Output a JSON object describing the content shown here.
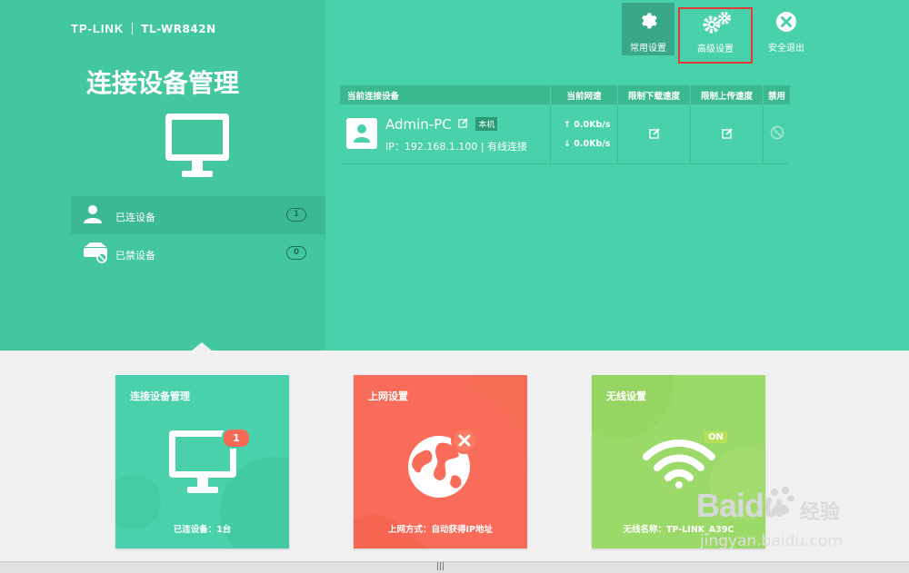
{
  "brand": {
    "logo": "TP-LINK",
    "model": "TL-WR842N"
  },
  "page_title": "连接设备管理",
  "nav": [
    {
      "label": "已连设备",
      "count": "1",
      "icon": "user-icon"
    },
    {
      "label": "已禁设备",
      "count": "0",
      "icon": "blocked-device-icon"
    }
  ],
  "top_buttons": {
    "common": "常用设置",
    "advanced": "高级设置",
    "exit": "安全退出"
  },
  "device_table": {
    "headers": [
      "当前连接设备",
      "当前网速",
      "限制下载速度",
      "限制上传速度",
      "禁用"
    ],
    "rows": [
      {
        "name": "Admin-PC",
        "tag": "本机",
        "ip": "IP：192.168.1.100 | 有线连接",
        "up": "0.0Kb/s",
        "down": "0.0Kb/s"
      }
    ]
  },
  "cards": [
    {
      "title": "连接设备管理",
      "badge": "1",
      "footer": "已连设备：1台"
    },
    {
      "title": "上网设置",
      "footer": "上网方式：自动获得IP地址"
    },
    {
      "title": "无线设置",
      "badge": "ON",
      "footer": "无线名称：TP-LINK_A39C"
    }
  ],
  "watermark": {
    "logo": "Baidu",
    "cn": "经验",
    "url": "jingyan.baidu.com"
  },
  "colors": {
    "teal": "#48d1aa",
    "teal_dark": "#43c79f",
    "red": "#f86c59",
    "green": "#9bd968",
    "highlight": "#e03c35"
  }
}
